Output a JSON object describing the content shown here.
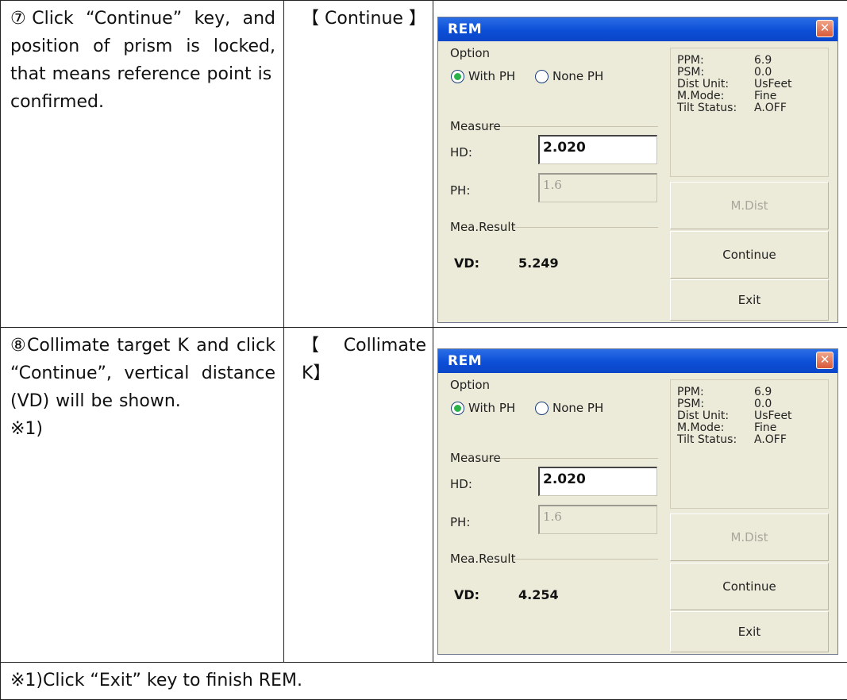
{
  "rows": [
    {
      "step_lines": [
        "⑦Click “Continue” key, and position of prism is locked, that means reference point is",
        "confirmed."
      ],
      "key": "【 Continue 】",
      "dialog": {
        "title": "REM",
        "option_label": "Option",
        "radio_with": "With PH",
        "radio_none": "None PH",
        "measure_label": "Measure",
        "hd_label": "HD:",
        "hd_value": "2.020",
        "ph_label": "PH:",
        "ph_value": "1.6",
        "result_label": "Mea.Result",
        "vd_label": "VD:",
        "vd_value": "5.249",
        "info": [
          {
            "k": "PPM:",
            "v": "6.9"
          },
          {
            "k": "PSM:",
            "v": "0.0"
          },
          {
            "k": "Dist Unit:",
            "v": "UsFeet"
          },
          {
            "k": "M.Mode:",
            "v": "Fine"
          },
          {
            "k": "Tilt Status:",
            "v": "A.OFF"
          }
        ],
        "btn_mdist": "M.Dist",
        "btn_continue": "Continue",
        "btn_exit": "Exit"
      }
    },
    {
      "step_lines": [
        "⑧Collimate target K and click “Continue”, vertical distance (VD) will be shown.",
        "※1)"
      ],
      "key": "【 Collimate K】",
      "dialog": {
        "title": "REM",
        "option_label": "Option",
        "radio_with": "With PH",
        "radio_none": "None PH",
        "measure_label": "Measure",
        "hd_label": "HD:",
        "hd_value": "2.020",
        "ph_label": "PH:",
        "ph_value": "1.6",
        "result_label": "Mea.Result",
        "vd_label": "VD:",
        "vd_value": "4.254",
        "info": [
          {
            "k": "PPM:",
            "v": "6.9"
          },
          {
            "k": "PSM:",
            "v": "0.0"
          },
          {
            "k": "Dist Unit:",
            "v": "UsFeet"
          },
          {
            "k": "M.Mode:",
            "v": "Fine"
          },
          {
            "k": "Tilt Status:",
            "v": "A.OFF"
          }
        ],
        "btn_mdist": "M.Dist",
        "btn_continue": "Continue",
        "btn_exit": "Exit"
      }
    }
  ],
  "footnote": "※1)Click “Exit” key to finish REM.",
  "colors": {
    "titlebar": "#0c4ed6",
    "dialog_bg": "#ecead8",
    "close": "#d9593a",
    "radio_dot": "#2bb34a"
  }
}
